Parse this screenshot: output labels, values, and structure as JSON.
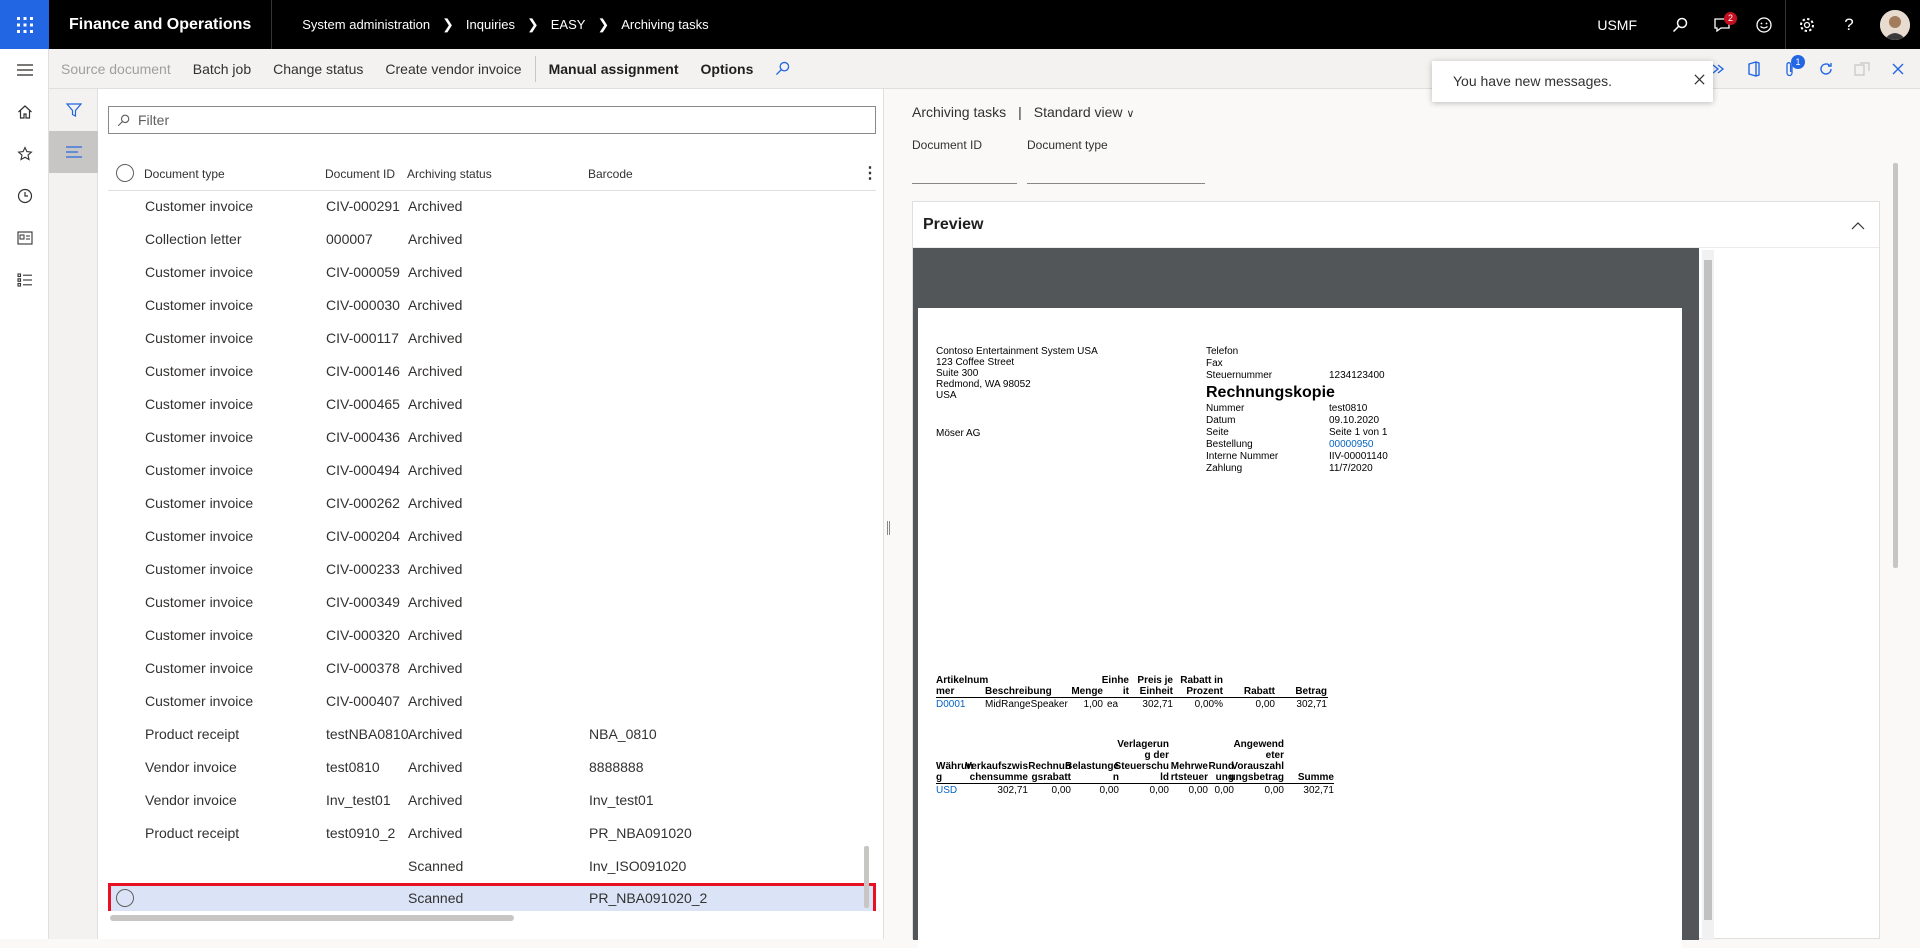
{
  "header": {
    "app_title": "Finance and Operations",
    "breadcrumbs": [
      "System administration",
      "Inquiries",
      "EASY",
      "Archiving tasks"
    ],
    "company": "USMF",
    "notification_count": "2"
  },
  "action_pane": {
    "items": [
      {
        "label": "Source document",
        "enabled": false
      },
      {
        "label": "Batch job",
        "enabled": true
      },
      {
        "label": "Change status",
        "enabled": true
      },
      {
        "label": "Create vendor invoice",
        "enabled": true
      },
      {
        "label": "Manual assignment",
        "enabled": true
      },
      {
        "label": "Options",
        "enabled": true
      }
    ],
    "attachments_badge": "1"
  },
  "toast": {
    "message": "You have new messages."
  },
  "list": {
    "filter_placeholder": "Filter",
    "columns": [
      "Document type",
      "Document ID",
      "Archiving status",
      "Barcode"
    ],
    "rows": [
      {
        "type": "Customer invoice",
        "id": "CIV-000291",
        "status": "Archived",
        "barcode": ""
      },
      {
        "type": "Collection letter",
        "id": "000007",
        "status": "Archived",
        "barcode": ""
      },
      {
        "type": "Customer invoice",
        "id": "CIV-000059",
        "status": "Archived",
        "barcode": ""
      },
      {
        "type": "Customer invoice",
        "id": "CIV-000030",
        "status": "Archived",
        "barcode": ""
      },
      {
        "type": "Customer invoice",
        "id": "CIV-000117",
        "status": "Archived",
        "barcode": ""
      },
      {
        "type": "Customer invoice",
        "id": "CIV-000146",
        "status": "Archived",
        "barcode": ""
      },
      {
        "type": "Customer invoice",
        "id": "CIV-000465",
        "status": "Archived",
        "barcode": ""
      },
      {
        "type": "Customer invoice",
        "id": "CIV-000436",
        "status": "Archived",
        "barcode": ""
      },
      {
        "type": "Customer invoice",
        "id": "CIV-000494",
        "status": "Archived",
        "barcode": ""
      },
      {
        "type": "Customer invoice",
        "id": "CIV-000262",
        "status": "Archived",
        "barcode": ""
      },
      {
        "type": "Customer invoice",
        "id": "CIV-000204",
        "status": "Archived",
        "barcode": ""
      },
      {
        "type": "Customer invoice",
        "id": "CIV-000233",
        "status": "Archived",
        "barcode": ""
      },
      {
        "type": "Customer invoice",
        "id": "CIV-000349",
        "status": "Archived",
        "barcode": ""
      },
      {
        "type": "Customer invoice",
        "id": "CIV-000320",
        "status": "Archived",
        "barcode": ""
      },
      {
        "type": "Customer invoice",
        "id": "CIV-000378",
        "status": "Archived",
        "barcode": ""
      },
      {
        "type": "Customer invoice",
        "id": "CIV-000407",
        "status": "Archived",
        "barcode": ""
      },
      {
        "type": "Product receipt",
        "id": "testNBA0810",
        "status": "Archived",
        "barcode": "NBA_0810"
      },
      {
        "type": "Vendor invoice",
        "id": "test0810",
        "status": "Archived",
        "barcode": "8888888"
      },
      {
        "type": "Vendor invoice",
        "id": "Inv_test01",
        "status": "Archived",
        "barcode": "Inv_test01"
      },
      {
        "type": "Product receipt",
        "id": "test0910_2",
        "status": "Archived",
        "barcode": "PR_NBA091020"
      },
      {
        "type": "",
        "id": "",
        "status": "Scanned",
        "barcode": "Inv_ISO091020"
      },
      {
        "type": "",
        "id": "",
        "status": "Scanned",
        "barcode": "PR_NBA091020_2",
        "selected": true
      }
    ]
  },
  "detail": {
    "title": "Archiving tasks",
    "view": "Standard view",
    "fields": {
      "document_id_label": "Document ID",
      "document_type_label": "Document type"
    },
    "preview_title": "Preview"
  },
  "invoice": {
    "sender": [
      "Contoso Entertainment System USA",
      "123 Coffee Street",
      "Suite 300",
      "Redmond, WA 98052",
      "USA"
    ],
    "recipient": "Möser AG",
    "contact_labels": [
      "Telefon",
      "Fax",
      "Steuernummer"
    ],
    "tax_number": "1234123400",
    "title": "Rechnungskopie",
    "info": [
      {
        "label": "Nummer",
        "value": "test0810"
      },
      {
        "label": "Datum",
        "value": "09.10.2020"
      },
      {
        "label": "Seite",
        "value": "Seite 1 von 1"
      },
      {
        "label": "Bestellung",
        "value": "00000950"
      },
      {
        "label": "Interne Nummer",
        "value": "IIV-00001140"
      },
      {
        "label": "Zahlung",
        "value": "11/7/2020"
      }
    ],
    "lines_header": {
      "item": [
        "Artikelnum",
        "mer"
      ],
      "desc": "Beschreibung",
      "qty": "Menge",
      "unit": [
        "Einhe",
        "it"
      ],
      "price": [
        "Preis je",
        "Einheit"
      ],
      "discpct": [
        "Rabatt in",
        "Prozent"
      ],
      "disc": "Rabatt",
      "amount": "Betrag"
    },
    "line": {
      "item": "D0001",
      "desc": "MidRangeSpeaker",
      "qty": "1,00",
      "unit": "ea",
      "price": "302,71",
      "discpct": "0,00%",
      "disc": "0,00",
      "amount": "302,71"
    },
    "totals_header": {
      "cur": [
        "Währun",
        "g"
      ],
      "sub": [
        "Verkaufszwis",
        "chensumme"
      ],
      "invdisc": [
        "Rechnun",
        "gsrabatt"
      ],
      "charges": [
        "Belastunge",
        "n"
      ],
      "taxdebt": [
        "Verlagerun",
        "g der",
        "Steuerschu",
        "ld"
      ],
      "vat": [
        "Mehrwe",
        "rtsteuer"
      ],
      "round": [
        "Rund",
        "ung"
      ],
      "prepay": [
        "Angewend",
        "eter",
        "Vorauszahl",
        "ungsbetrag"
      ],
      "total": "Summe"
    },
    "totals": {
      "cur": "USD",
      "sub": "302,71",
      "invdisc": "0,00",
      "charges": "0,00",
      "taxdebt": "0,00",
      "vat": "0,00",
      "round": "0,00",
      "prepay": "0,00",
      "total": "302,71"
    }
  }
}
